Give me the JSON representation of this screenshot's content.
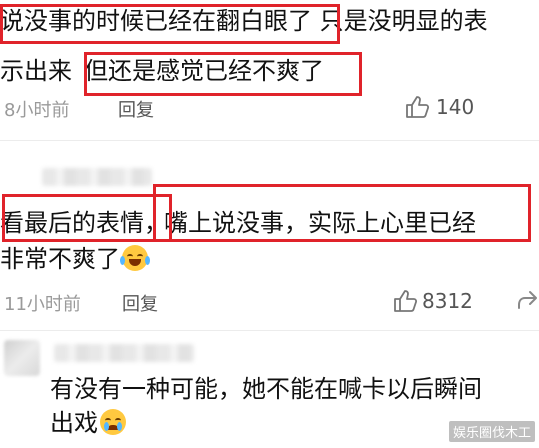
{
  "comments": [
    {
      "line1_highlight": "说没事的时候已经在翻白眼了",
      "line1_rest": " 只是没明显的表",
      "line2_lead": "示出来",
      "line2_highlight": "但还是感觉已经不爽了",
      "time": "8小时前",
      "reply_label": "回复",
      "likes": "140"
    },
    {
      "line1_a": "看最后的表情",
      "line1_b": "，",
      "line1_highlight": "嘴上说没事，实际上心里已经",
      "line2": "非常不爽了",
      "emoji": "laugh-cry-emoji",
      "time": "11小时前",
      "reply_label": "回复",
      "likes": "8312"
    },
    {
      "line1": "有没有一种可能，她不能在喊卡以后瞬间",
      "line2": "出戏",
      "emoji": "crying-emoji"
    }
  ],
  "watermark": "娱乐圈伐木工",
  "colors": {
    "highlight_border": "#e0232a",
    "meta": "#9a9a9a"
  }
}
